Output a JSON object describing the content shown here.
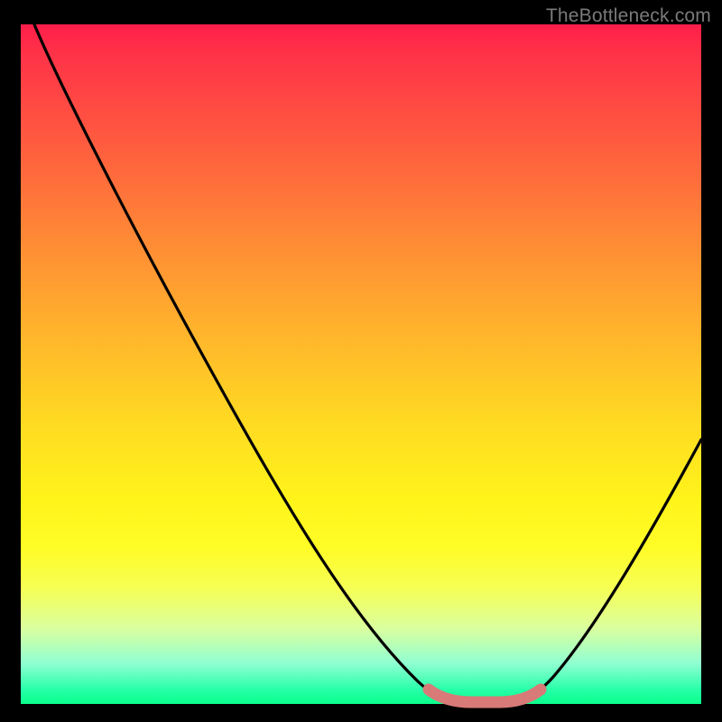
{
  "watermark": "TheBottleneck.com",
  "chart_data": {
    "type": "line",
    "title": "",
    "xlabel": "",
    "ylabel": "",
    "xlim": [
      0,
      100
    ],
    "ylim": [
      0,
      100
    ],
    "grid": false,
    "legend": false,
    "series": [
      {
        "name": "bottleneck-curve",
        "x": [
          2,
          10,
          20,
          30,
          40,
          50,
          58,
          62,
          66,
          70,
          74,
          80,
          88,
          96,
          100
        ],
        "y": [
          100,
          86,
          70,
          54,
          38,
          22,
          8,
          2,
          0,
          0,
          2,
          9,
          22,
          36,
          43
        ]
      },
      {
        "name": "optimal-band",
        "x": [
          61,
          64,
          67,
          70,
          73
        ],
        "y": [
          2,
          0.5,
          0,
          0.5,
          2
        ]
      }
    ],
    "colors": {
      "curve": "#000000",
      "band": "#d87a78"
    }
  }
}
